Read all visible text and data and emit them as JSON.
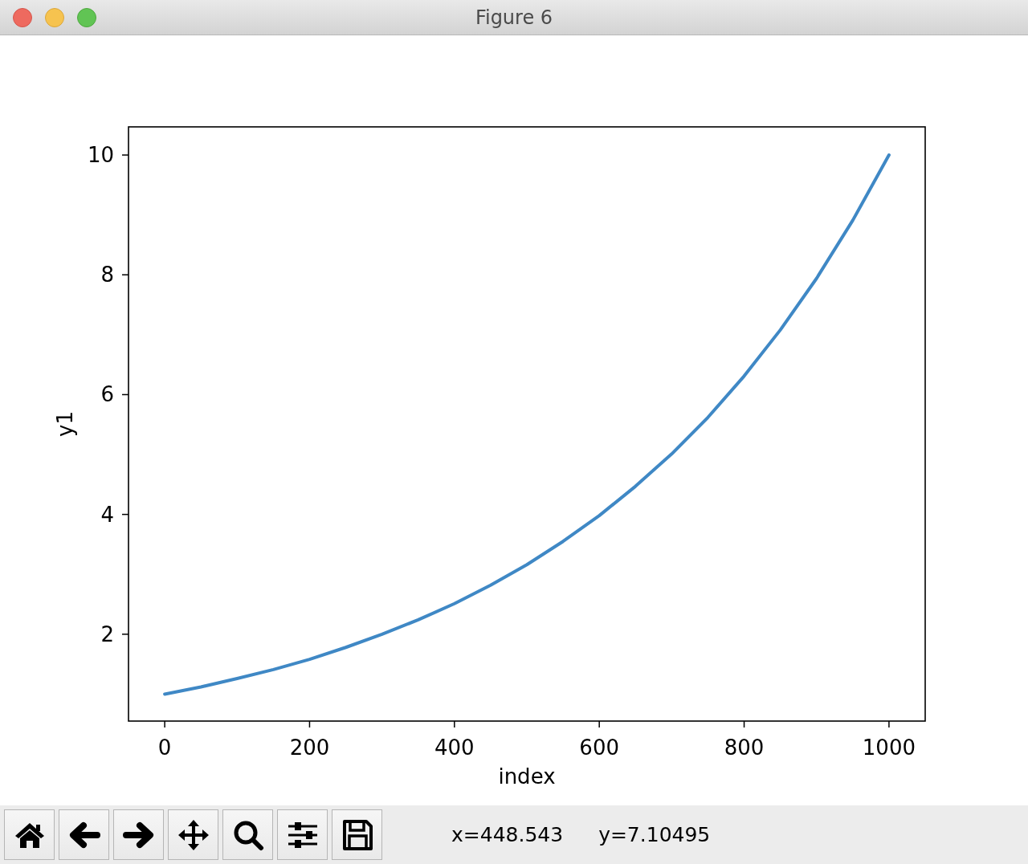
{
  "window": {
    "title": "Figure 6"
  },
  "chart_data": {
    "type": "line",
    "xlabel": "index",
    "ylabel": "y1",
    "x": [
      0,
      50,
      100,
      150,
      200,
      250,
      300,
      350,
      400,
      450,
      500,
      550,
      600,
      650,
      700,
      750,
      800,
      850,
      900,
      950,
      1000
    ],
    "series": [
      {
        "color": "#3f88c5",
        "values": [
          1,
          1.12,
          1.26,
          1.41,
          1.58,
          1.78,
          2,
          2.24,
          2.51,
          2.82,
          3.16,
          3.55,
          3.98,
          4.47,
          5.01,
          5.62,
          6.31,
          7.08,
          7.94,
          8.91,
          10
        ]
      }
    ],
    "xlim": [
      -50,
      1050
    ],
    "ylim": [
      0.55,
      10.47
    ],
    "xticks": [
      0,
      200,
      400,
      600,
      800,
      1000
    ],
    "yticks": [
      2,
      4,
      6,
      8,
      10
    ]
  },
  "toolbar": {
    "tools": [
      {
        "kind": "home"
      },
      {
        "kind": "back"
      },
      {
        "kind": "forward"
      },
      {
        "kind": "pan"
      },
      {
        "kind": "zoom"
      },
      {
        "kind": "subplots"
      },
      {
        "kind": "save"
      }
    ],
    "x_readout": "x=448.543",
    "y_readout": "y=7.10495"
  }
}
